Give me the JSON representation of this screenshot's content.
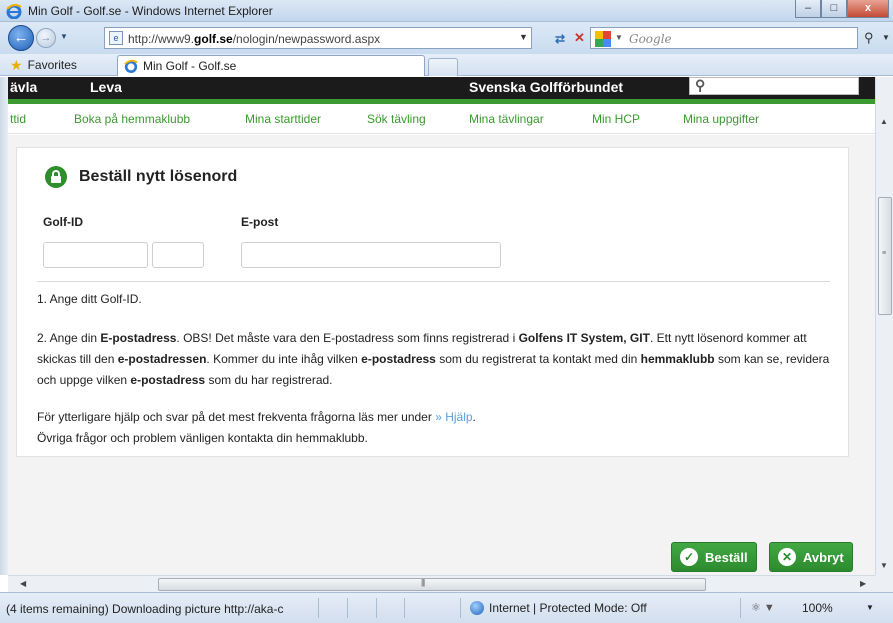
{
  "window": {
    "title": "Min Golf - Golf.se - Windows Internet Explorer",
    "minimize_label": "–",
    "maximize_label": "□",
    "close_label": "x"
  },
  "address": {
    "url_prefix": "http://www9.",
    "url_domain": "golf.se",
    "url_path": "/nologin/newpassword.aspx",
    "search_provider": "Google"
  },
  "favorites": {
    "label": "Favorites",
    "tab_title": "Min Golf - Golf.se"
  },
  "site_nav": {
    "items": [
      "ävla",
      "Leva",
      "Svenska Golfförbundet"
    ],
    "search_placeholder": ""
  },
  "subnav": {
    "links": [
      "ttid",
      "Boka på hemmaklubb",
      "Mina starttider",
      "Sök tävling",
      "Mina tävlingar",
      "Min HCP",
      "Mina uppgifter"
    ]
  },
  "form": {
    "title": "Beställ nytt lösenord",
    "golfid_label": "Golf-ID",
    "email_label": "E-post",
    "golfid_value_1": "",
    "golfid_value_2": "",
    "email_value": ""
  },
  "instructions": {
    "step1": "1. Ange ditt Golf-ID.",
    "step2_parts": [
      "2. Ange din ",
      "E-postadress",
      ". OBS! Det måste vara den E-postadress som finns registrerad i ",
      "Golfens IT System, GIT",
      ". Ett nytt lösenord kommer att skickas till den ",
      "e-postadressen",
      ". Kommer du inte ihåg vilken ",
      "e-postadress",
      " som du registrerat ta kontakt med din ",
      "hemmaklubb",
      " som kan se, revidera och uppge vilken ",
      "e-postadress",
      " som du har registrerad."
    ],
    "help_prefix": "För ytterligare hjälp och svar på det mest frekventa frågorna läs mer under ",
    "help_link": "» Hjälp",
    "help_suffix": ".",
    "contact": "Övriga frågor och problem vänligen kontakta din hemmaklubb."
  },
  "buttons": {
    "order": "Beställ",
    "cancel": "Avbryt"
  },
  "status": {
    "text": "(4 items remaining) Downloading picture http://aka-c",
    "zone": "Internet | Protected Mode: Off",
    "zoom": "100%"
  },
  "colors": {
    "brand_green": "#3c9a32",
    "nav_black": "#1b1b1b",
    "link_blue": "#5aa0d6"
  }
}
